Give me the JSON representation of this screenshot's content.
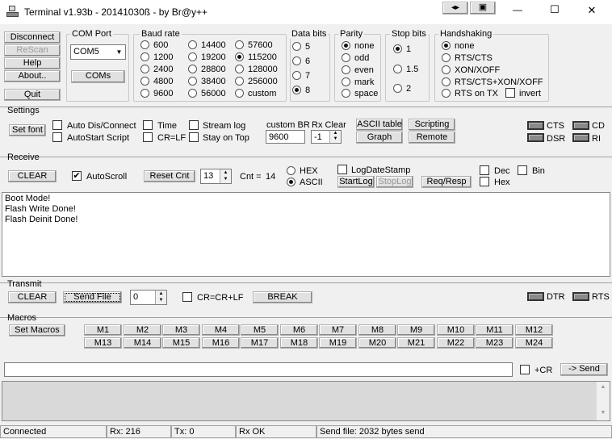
{
  "title_bar": {
    "title": "Terminal v1.93b - 20141030ß - by Br@y++",
    "swap_icon": "◂▸",
    "dock_icon": "▣",
    "min": "—",
    "max": "☐",
    "close": "✕"
  },
  "buttons_left": {
    "disconnect": "Disconnect",
    "rescan": "ReScan",
    "help": "Help",
    "about": "About..",
    "quit": "Quit"
  },
  "com_port": {
    "label": "COM Port",
    "value": "COM5",
    "coms": "COMs"
  },
  "baud_rate": {
    "label": "Baud rate",
    "options": [
      "600",
      "1200",
      "2400",
      "4800",
      "9600",
      "14400",
      "19200",
      "28800",
      "38400",
      "56000",
      "57600",
      "115200",
      "128000",
      "256000",
      "custom"
    ],
    "selected": "115200"
  },
  "data_bits": {
    "label": "Data bits",
    "options": [
      "5",
      "6",
      "7",
      "8"
    ],
    "selected": "8"
  },
  "parity": {
    "label": "Parity",
    "options": [
      "none",
      "odd",
      "even",
      "mark",
      "space"
    ],
    "selected": "none"
  },
  "stop_bits": {
    "label": "Stop bits",
    "options": [
      "1",
      "1.5",
      "2"
    ],
    "selected": "1"
  },
  "handshaking": {
    "label": "Handshaking",
    "options": [
      "none",
      "RTS/CTS",
      "XON/XOFF",
      "RTS/CTS+XON/XOFF",
      "RTS on TX"
    ],
    "selected": "none",
    "invert": "invert"
  },
  "settings": {
    "label": "Settings",
    "set_font": "Set font",
    "auto_dis": "Auto Dis/Connect",
    "autostart": "AutoStart Script",
    "time": "Time",
    "crlf": "CR=LF",
    "stream_log": "Stream log",
    "stay_on_top": "Stay on Top",
    "custom_br_label": "custom BR",
    "custom_br_value": "9600",
    "rx_clear_label": "Rx Clear",
    "rx_clear_value": "-1",
    "ascii_table": "ASCII table",
    "scripting": "Scripting",
    "graph": "Graph",
    "remote": "Remote",
    "cts": "CTS",
    "cd": "CD",
    "dsr": "DSR",
    "ri": "RI"
  },
  "receive": {
    "label": "Receive",
    "clear": "CLEAR",
    "autoscroll": "AutoScroll",
    "reset_cnt": "Reset Cnt",
    "cnt_value": "13",
    "cnt_label": "Cnt =",
    "cnt": "14",
    "hex": "HEX",
    "ascii": "ASCII",
    "log_date_stamp": "LogDateStamp",
    "start_log": "StartLog",
    "stop_log": "StopLog",
    "req_resp": "Req/Resp",
    "dec": "Dec",
    "hex2": "Hex",
    "bin": "Bin"
  },
  "terminal_lines": [
    "Boot Mode!",
    "Flash Write Done!",
    "Flash Deinit Done!"
  ],
  "transmit": {
    "label": "Transmit",
    "clear": "CLEAR",
    "send_file": "Send File",
    "spin_value": "0",
    "crcrlf": "CR=CR+LF",
    "break": "BREAK",
    "dtr": "DTR",
    "rts": "RTS"
  },
  "macros": {
    "label": "Macros",
    "set_macros": "Set Macros",
    "row1": [
      "M1",
      "M2",
      "M3",
      "M4",
      "M5",
      "M6",
      "M7",
      "M8",
      "M9",
      "M10",
      "M11",
      "M12"
    ],
    "row2": [
      "M13",
      "M14",
      "M15",
      "M16",
      "M17",
      "M18",
      "M19",
      "M20",
      "M21",
      "M22",
      "M23",
      "M24"
    ]
  },
  "send_bar": {
    "cr_label": "+CR",
    "send": "-> Send"
  },
  "status": {
    "connected": "Connected",
    "rx": "Rx: 216",
    "tx": "Tx: 0",
    "rx_ok": "Rx OK",
    "send_file": "Send file: 2032 bytes send"
  }
}
